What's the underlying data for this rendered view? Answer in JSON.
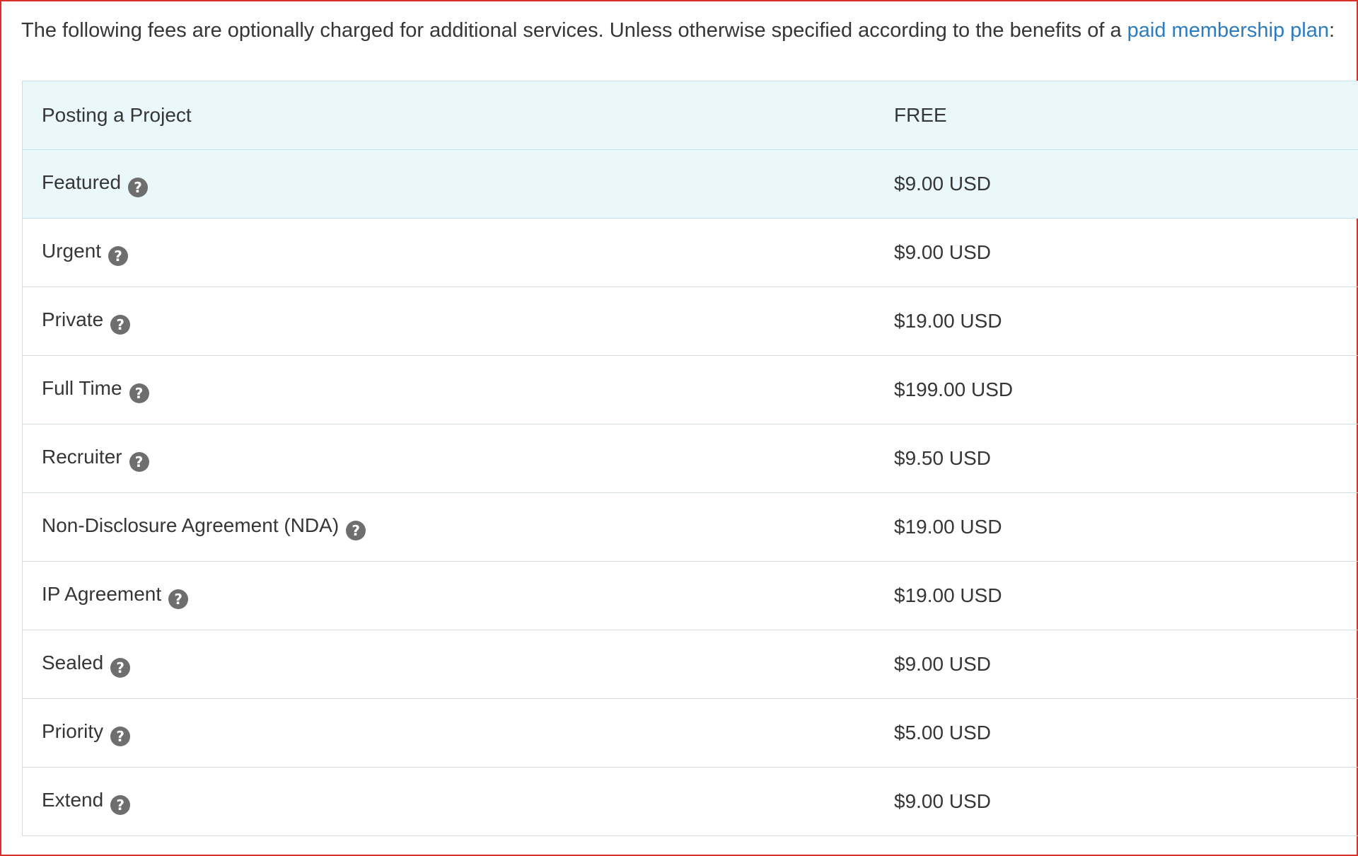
{
  "intro": {
    "text": "The following fees are optionally charged for additional services. Unless otherwise specified according to the benefits of a ",
    "link_text": "paid membership plan",
    "suffix": ":"
  },
  "help_icon_glyph": "?",
  "icons": {
    "help": "question-circle-icon"
  },
  "colors": {
    "link": "#2b7cc0",
    "highlight_row": "#eaf7fb",
    "icon": "#6e6e6e",
    "frame_border": "#d6322b"
  },
  "fees": [
    {
      "name": "Posting a Project",
      "price": "FREE",
      "has_help": false,
      "highlight": true
    },
    {
      "name": "Featured",
      "price": "$9.00 USD",
      "has_help": true,
      "highlight": true
    },
    {
      "name": "Urgent",
      "price": "$9.00 USD",
      "has_help": true,
      "highlight": false
    },
    {
      "name": "Private",
      "price": "$19.00 USD",
      "has_help": true,
      "highlight": false
    },
    {
      "name": "Full Time",
      "price": "$199.00 USD",
      "has_help": true,
      "highlight": false
    },
    {
      "name": "Recruiter",
      "price": "$9.50 USD",
      "has_help": true,
      "highlight": false
    },
    {
      "name": "Non-Disclosure Agreement (NDA)",
      "price": "$19.00 USD",
      "has_help": true,
      "highlight": false
    },
    {
      "name": "IP Agreement",
      "price": "$19.00 USD",
      "has_help": true,
      "highlight": false
    },
    {
      "name": "Sealed",
      "price": "$9.00 USD",
      "has_help": true,
      "highlight": false
    },
    {
      "name": "Priority",
      "price": "$5.00 USD",
      "has_help": true,
      "highlight": false
    },
    {
      "name": "Extend",
      "price": "$9.00 USD",
      "has_help": true,
      "highlight": false
    }
  ]
}
